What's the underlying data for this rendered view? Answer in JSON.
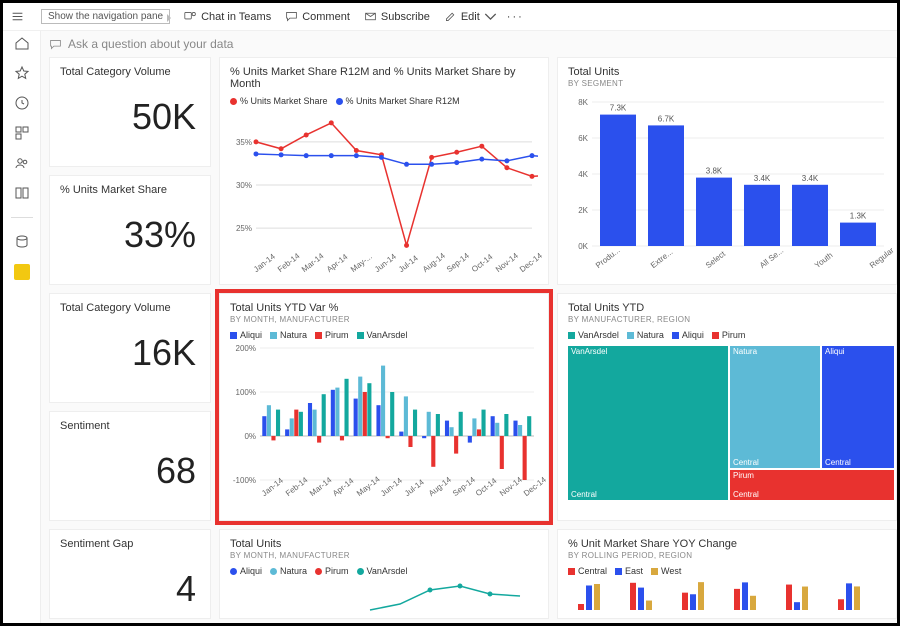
{
  "topbar": {
    "tooltip": "Show the navigation pane",
    "chat": "Chat in Teams",
    "comment": "Comment",
    "subscribe": "Subscribe",
    "edit": "Edit",
    "more": "···"
  },
  "qa_placeholder": "Ask a question about your data",
  "kpis": {
    "cat_vol": {
      "title": "Total Category Volume",
      "value": "50K"
    },
    "share": {
      "title": "% Units Market Share",
      "value": "33%"
    },
    "cat_vol2": {
      "title": "Total Category Volume",
      "value": "16K"
    },
    "sentiment": {
      "title": "Sentiment",
      "value": "68"
    },
    "gap": {
      "title": "Sentiment Gap",
      "value": "4"
    }
  },
  "tiles": {
    "share_trend": {
      "title": "% Units Market Share R12M and % Units Market Share by Month",
      "legend": [
        "% Units Market Share",
        "% Units Market Share R12M"
      ]
    },
    "total_units_seg": {
      "title": "Total Units",
      "sub": "BY SEGMENT"
    },
    "ytd_var": {
      "title": "Total Units YTD Var %",
      "sub": "BY MONTH, MANUFACTURER",
      "legend": [
        "Aliqui",
        "Natura",
        "Pirum",
        "VanArsdel"
      ]
    },
    "ytd_tree": {
      "title": "Total Units YTD",
      "sub": "BY MANUFACTURER, REGION",
      "legend": [
        "VanArsdel",
        "Natura",
        "Aliqui",
        "Pirum"
      ]
    },
    "total_units_mfr": {
      "title": "Total Units",
      "sub": "BY MONTH, MANUFACTURER",
      "legend": [
        "Aliqui",
        "Natura",
        "Pirum",
        "VanArsdel"
      ]
    },
    "yoy": {
      "title": "% Unit Market Share YOY Change",
      "sub": "BY ROLLING PERIOD, REGION",
      "legend": [
        "Central",
        "East",
        "West"
      ]
    }
  },
  "months": [
    "Jan-14",
    "Feb-14",
    "Mar-14",
    "Apr-14",
    "May-...",
    "Jun-14",
    "Jul-14",
    "Aug-14",
    "Sep-14",
    "Oct-14",
    "Nov-14",
    "Dec-14"
  ],
  "months2": [
    "Jan-14",
    "Feb-14",
    "Mar-14",
    "Apr-14",
    "May-14",
    "Jun-14",
    "Jul-14",
    "Aug-14",
    "Sep-14",
    "Oct-14",
    "Nov-14",
    "Dec-14"
  ],
  "segments": [
    "Produ...",
    "Extre...",
    "Select",
    "All Se...",
    "Youth",
    "Regular"
  ],
  "colors": {
    "red": "#e8322f",
    "blue": "#2b50ed",
    "teal": "#13a89e",
    "cyan": "#5dbad6",
    "gold": "#d8a83e",
    "navy": "#3f51c9"
  },
  "chart_data": [
    {
      "id": "share_trend",
      "type": "line",
      "x": [
        "Jan-14",
        "Feb-14",
        "Mar-14",
        "Apr-14",
        "May-14",
        "Jun-14",
        "Jul-14",
        "Aug-14",
        "Sep-14",
        "Oct-14",
        "Nov-14",
        "Dec-14"
      ],
      "series": [
        {
          "name": "% Units Market Share",
          "color": "#e8322f",
          "values": [
            35,
            34.2,
            35.8,
            37.2,
            34,
            33.5,
            23,
            33.2,
            33.8,
            34.5,
            32,
            31,
            31.2
          ]
        },
        {
          "name": "% Units Market Share R12M",
          "color": "#2b50ed",
          "values": [
            33.6,
            33.5,
            33.4,
            33.4,
            33.4,
            33.2,
            32.4,
            32.4,
            32.6,
            33,
            32.8,
            33.4,
            33.2
          ]
        }
      ],
      "ylabel": "",
      "ylim": [
        22,
        38
      ],
      "yticks": [
        25,
        30,
        35
      ]
    },
    {
      "id": "total_units_seg",
      "type": "bar",
      "categories": [
        "Productivity",
        "Extreme",
        "Select",
        "All Season",
        "Youth",
        "Regular"
      ],
      "values": [
        7300,
        6700,
        3800,
        3400,
        3400,
        1300
      ],
      "labels": [
        "7.3K",
        "6.7K",
        "3.8K",
        "3.4K",
        "3.4K",
        "1.3K"
      ],
      "color": "#2b50ed",
      "ylim": [
        0,
        8000
      ],
      "yticks": [
        0,
        2000,
        4000,
        6000,
        8000
      ],
      "ytick_labels": [
        "0K",
        "2K",
        "4K",
        "6K",
        "8K"
      ]
    },
    {
      "id": "ytd_var",
      "type": "bar_grouped",
      "x": [
        "Jan-14",
        "Feb-14",
        "Mar-14",
        "Apr-14",
        "May-14",
        "Jun-14",
        "Jul-14",
        "Aug-14",
        "Sep-14",
        "Oct-14",
        "Nov-14",
        "Dec-14"
      ],
      "series": [
        {
          "name": "Aliqui",
          "color": "#2b50ed",
          "values": [
            45,
            15,
            75,
            105,
            85,
            70,
            10,
            -5,
            35,
            -15,
            45,
            35
          ]
        },
        {
          "name": "Natura",
          "color": "#5dbad6",
          "values": [
            70,
            40,
            60,
            110,
            135,
            160,
            90,
            55,
            20,
            40,
            30,
            25
          ]
        },
        {
          "name": "Pirum",
          "color": "#e8322f",
          "values": [
            -10,
            60,
            -15,
            -10,
            100,
            -5,
            -25,
            -70,
            -40,
            15,
            -75,
            -100
          ]
        },
        {
          "name": "VanArsdel",
          "color": "#13a89e",
          "values": [
            60,
            55,
            95,
            130,
            120,
            100,
            60,
            50,
            55,
            60,
            50,
            45
          ]
        }
      ],
      "ylim": [
        -100,
        200
      ],
      "yticks": [
        -100,
        0,
        100,
        200
      ],
      "ytick_labels": [
        "-100%",
        "0%",
        "100%",
        "200%"
      ]
    },
    {
      "id": "ytd_tree",
      "type": "treemap",
      "nodes": [
        {
          "name": "VanArsdel",
          "region": "Central",
          "value": 50,
          "color": "#13a89e"
        },
        {
          "name": "Natura",
          "region": "Central",
          "value": 20,
          "color": "#5dbad6"
        },
        {
          "name": "Aliqui",
          "region": "Central",
          "value": 18,
          "color": "#2b50ed"
        },
        {
          "name": "Pirum",
          "region": "Central",
          "value": 12,
          "color": "#e8322f"
        }
      ]
    },
    {
      "id": "yoy",
      "type": "bar_grouped",
      "series": [
        {
          "name": "Central",
          "color": "#e8322f"
        },
        {
          "name": "East",
          "color": "#2b50ed"
        },
        {
          "name": "West",
          "color": "#d8a83e"
        }
      ]
    }
  ]
}
